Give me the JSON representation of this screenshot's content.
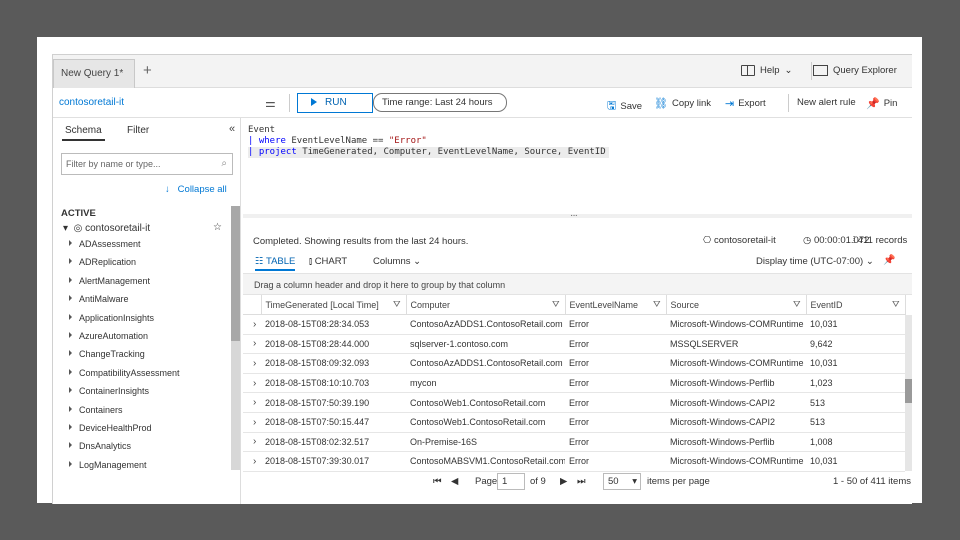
{
  "tabbar": {
    "active_tab": "New Query 1*",
    "add_tab": "+",
    "help": "Help",
    "query_explorer": "Query Explorer"
  },
  "toolbar": {
    "workspace": "contosoretail-it",
    "run": "RUN",
    "time_range": "Time range: Last 24 hours",
    "save": "Save",
    "copy_link": "Copy link",
    "export": "Export",
    "new_alert_rule": "New alert rule",
    "pin": "Pin"
  },
  "left": {
    "tab_schema": "Schema",
    "tab_filter": "Filter",
    "search_placeholder": "Filter by name or type...",
    "collapse_all": "Collapse all",
    "section": "ACTIVE",
    "workspace_node": "contosoretail-it",
    "items": [
      "ADAssessment",
      "ADReplication",
      "AlertManagement",
      "AntiMalware",
      "ApplicationInsights",
      "AzureAutomation",
      "ChangeTracking",
      "CompatibilityAssessment",
      "ContainerInsights",
      "Containers",
      "DeviceHealthProd",
      "DnsAnalytics",
      "LogManagement"
    ]
  },
  "query": {
    "line1": "Event",
    "line2_kw": "| where",
    "line2_rest": " EventLevelName == ",
    "line2_str": "\"Error\"",
    "line3_kw": "| project",
    "line3_rest": " TimeGenerated, Computer, EventLevelName, Source, EventID"
  },
  "results": {
    "status": "Completed. Showing results from the last 24 hours.",
    "workspace": "contosoretail-it",
    "duration": "00:00:01.072",
    "records": "411 records",
    "tab_table": "TABLE",
    "tab_chart": "CHART",
    "columns_label": "Columns",
    "display_time": "Display time (UTC-07:00)",
    "group_hint": "Drag a column header and drop it here to group by that column",
    "headers": [
      "TimeGenerated [Local Time]",
      "Computer",
      "EventLevelName",
      "Source",
      "EventID"
    ],
    "rows": [
      [
        "2018-08-15T08:28:34.053",
        "ContosoAzADDS1.ContosoRetail.com",
        "Error",
        "Microsoft-Windows-COMRuntime",
        "10,031"
      ],
      [
        "2018-08-15T08:28:44.000",
        "sqlserver-1.contoso.com",
        "Error",
        "MSSQLSERVER",
        "9,642"
      ],
      [
        "2018-08-15T08:09:32.093",
        "ContosoAzADDS1.ContosoRetail.com",
        "Error",
        "Microsoft-Windows-COMRuntime",
        "10,031"
      ],
      [
        "2018-08-15T08:10:10.703",
        "mycon",
        "Error",
        "Microsoft-Windows-Perflib",
        "1,023"
      ],
      [
        "2018-08-15T07:50:39.190",
        "ContosoWeb1.ContosoRetail.com",
        "Error",
        "Microsoft-Windows-CAPI2",
        "513"
      ],
      [
        "2018-08-15T07:50:15.447",
        "ContosoWeb1.ContosoRetail.com",
        "Error",
        "Microsoft-Windows-CAPI2",
        "513"
      ],
      [
        "2018-08-15T08:02:32.517",
        "On-Premise-16S",
        "Error",
        "Microsoft-Windows-Perflib",
        "1,008"
      ],
      [
        "2018-08-15T07:39:30.017",
        "ContosoMABSVM1.ContosoRetail.com",
        "Error",
        "Microsoft-Windows-COMRuntime",
        "10,031"
      ]
    ]
  },
  "pager": {
    "page_label": "Page",
    "page_value": "1",
    "of_label": "of 9",
    "page_size": "50",
    "items_per_page": "items per page",
    "range": "1 - 50 of 411 items"
  }
}
